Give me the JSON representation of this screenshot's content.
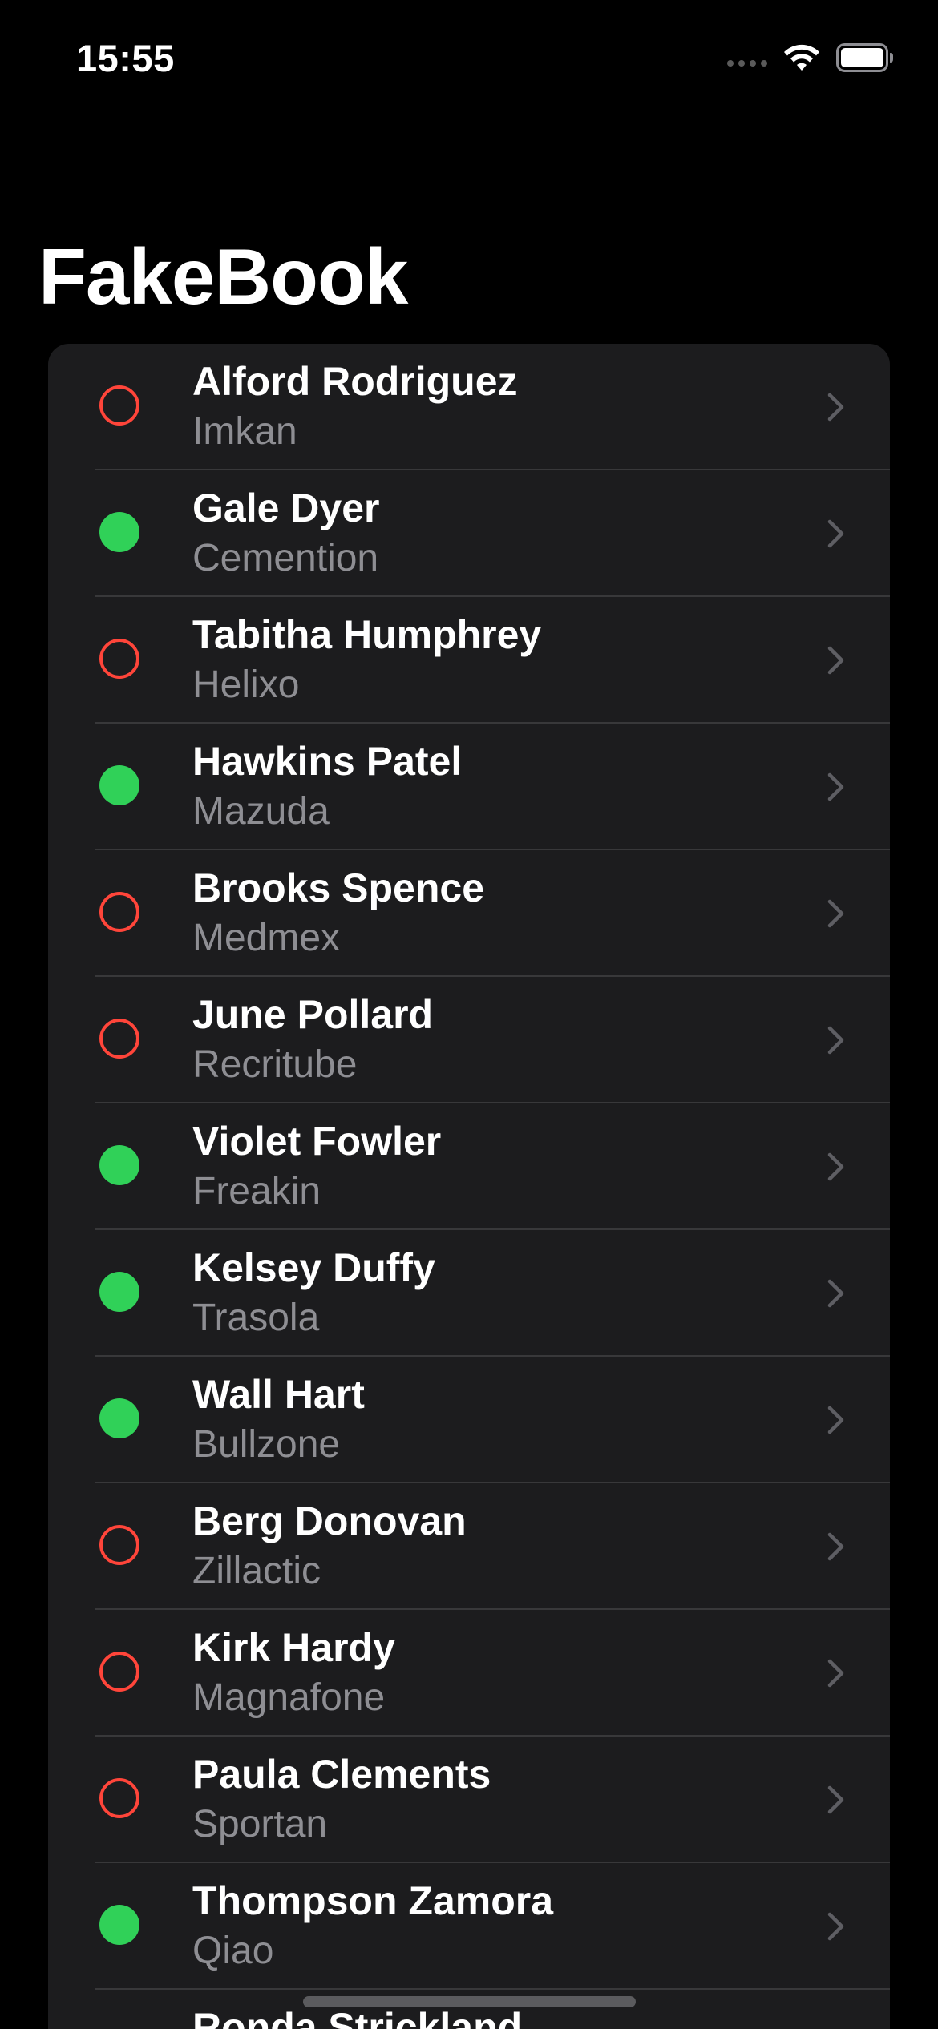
{
  "status_bar": {
    "time": "15:55",
    "icons": [
      "cellular-signal-icon",
      "wifi-icon",
      "battery-icon"
    ]
  },
  "header": {
    "title": "FakeBook"
  },
  "colors": {
    "online": "#30d158",
    "offline": "#ff453a",
    "card_background": "#1c1c1e",
    "secondary_text": "#8e8e93"
  },
  "contacts": [
    {
      "name": "Alford Rodriguez",
      "company": "Imkan",
      "status": "offline"
    },
    {
      "name": "Gale Dyer",
      "company": "Cemention",
      "status": "online"
    },
    {
      "name": "Tabitha Humphrey",
      "company": "Helixo",
      "status": "offline"
    },
    {
      "name": "Hawkins Patel",
      "company": "Mazuda",
      "status": "online"
    },
    {
      "name": "Brooks Spence",
      "company": "Medmex",
      "status": "offline"
    },
    {
      "name": "June Pollard",
      "company": "Recritube",
      "status": "offline"
    },
    {
      "name": "Violet Fowler",
      "company": "Freakin",
      "status": "online"
    },
    {
      "name": "Kelsey Duffy",
      "company": "Trasola",
      "status": "online"
    },
    {
      "name": "Wall Hart",
      "company": "Bullzone",
      "status": "online"
    },
    {
      "name": "Berg Donovan",
      "company": "Zillactic",
      "status": "offline"
    },
    {
      "name": "Kirk Hardy",
      "company": "Magnafone",
      "status": "offline"
    },
    {
      "name": "Paula Clements",
      "company": "Sportan",
      "status": "offline"
    },
    {
      "name": "Thompson Zamora",
      "company": "Qiao",
      "status": "online"
    },
    {
      "name": "Ronda Strickland",
      "company": "",
      "status": "offline"
    }
  ]
}
